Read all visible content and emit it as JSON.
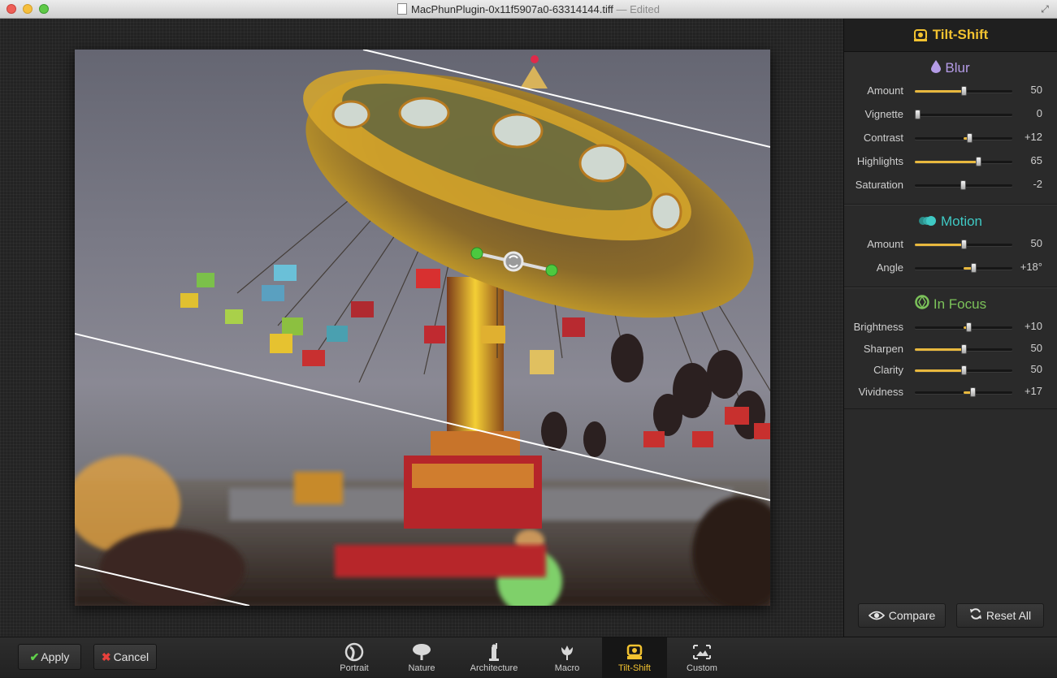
{
  "window": {
    "title": "MacPhunPlugin-0x11f5907a0-63314144.tiff",
    "status": "— Edited"
  },
  "sidebar": {
    "header": "Tilt-Shift",
    "blur": {
      "title": "Blur",
      "sliders": [
        {
          "label": "Amount",
          "value": "50",
          "pos": 0.5,
          "fill_from": 0,
          "fill_to": 0.5
        },
        {
          "label": "Vignette",
          "value": "0",
          "pos": 0.0,
          "fill_from": 0,
          "fill_to": 0
        },
        {
          "label": "Contrast",
          "value": "+12",
          "pos": 0.56,
          "fill_from": 0.5,
          "fill_to": 0.56
        },
        {
          "label": "Highlights",
          "value": "65",
          "pos": 0.65,
          "fill_from": 0,
          "fill_to": 0.65
        },
        {
          "label": "Saturation",
          "value": "-2",
          "pos": 0.49,
          "fill_from": 0.49,
          "fill_to": 0.5
        }
      ]
    },
    "motion": {
      "title": "Motion",
      "sliders": [
        {
          "label": "Amount",
          "value": "50",
          "pos": 0.5,
          "fill_from": 0,
          "fill_to": 0.5
        },
        {
          "label": "Angle",
          "value": "+18°",
          "pos": 0.6,
          "fill_from": 0.5,
          "fill_to": 0.6
        }
      ]
    },
    "focus": {
      "title": "In Focus",
      "sliders": [
        {
          "label": "Brightness",
          "value": "+10",
          "pos": 0.55,
          "fill_from": 0.5,
          "fill_to": 0.55
        },
        {
          "label": "Sharpen",
          "value": "50",
          "pos": 0.5,
          "fill_from": 0,
          "fill_to": 0.5
        },
        {
          "label": "Clarity",
          "value": "50",
          "pos": 0.5,
          "fill_from": 0,
          "fill_to": 0.5
        },
        {
          "label": "Vividness",
          "value": "+17",
          "pos": 0.59,
          "fill_from": 0.5,
          "fill_to": 0.59
        }
      ]
    },
    "buttons": {
      "compare": "Compare",
      "reset": "Reset All"
    }
  },
  "bottom": {
    "apply": "Apply",
    "cancel": "Cancel",
    "presets": [
      {
        "label": "Portrait",
        "active": false
      },
      {
        "label": "Nature",
        "active": false
      },
      {
        "label": "Architecture",
        "active": false
      },
      {
        "label": "Macro",
        "active": false
      },
      {
        "label": "Tilt-Shift",
        "active": true
      },
      {
        "label": "Custom",
        "active": false
      }
    ]
  },
  "colors": {
    "accent": "#f2c230",
    "blur": "#b49be6",
    "motion": "#3fc9c4",
    "focus": "#7cc35a",
    "handle": "#4cc93f"
  }
}
